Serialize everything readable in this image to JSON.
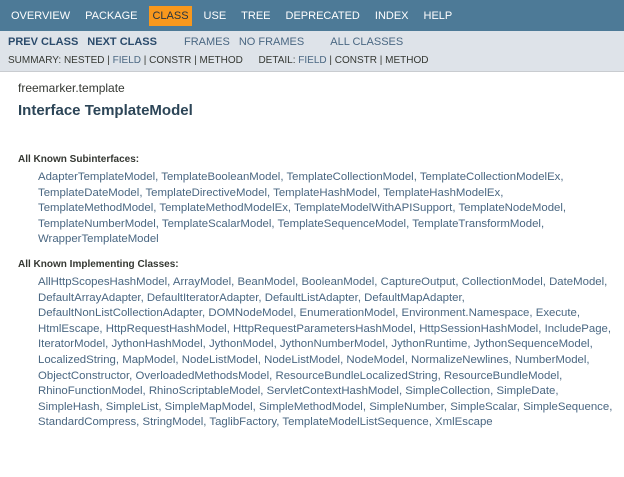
{
  "topnav": {
    "items": [
      {
        "label": "OVERVIEW",
        "active": false
      },
      {
        "label": "PACKAGE",
        "active": false
      },
      {
        "label": "CLASS",
        "active": true
      },
      {
        "label": "USE",
        "active": false
      },
      {
        "label": "TREE",
        "active": false
      },
      {
        "label": "DEPRECATED",
        "active": false
      },
      {
        "label": "INDEX",
        "active": false
      },
      {
        "label": "HELP",
        "active": false
      }
    ]
  },
  "subnav": {
    "prev_class": "PREV CLASS",
    "next_class": "NEXT CLASS",
    "frames": "FRAMES",
    "no_frames": "NO FRAMES",
    "all_classes": "ALL CLASSES",
    "summary_label": "SUMMARY: NESTED |",
    "summary_field": "FIELD",
    "summary_rest": "| CONSTR | METHOD",
    "detail_label": "DETAIL:",
    "detail_field": "FIELD",
    "detail_rest": "| CONSTR | METHOD"
  },
  "header": {
    "package": "freemarker.template",
    "title": "Interface TemplateModel"
  },
  "subinterfaces": {
    "label": "All Known Subinterfaces:",
    "items": [
      "AdapterTemplateModel",
      "TemplateBooleanModel",
      "TemplateCollectionModel",
      "TemplateCollectionModelEx",
      "TemplateDateModel",
      "TemplateDirectiveModel",
      "TemplateHashModel",
      "TemplateHashModelEx",
      "TemplateMethodModel",
      "TemplateMethodModelEx",
      "TemplateModelWithAPISupport",
      "TemplateNodeModel",
      "TemplateNumberModel",
      "TemplateScalarModel",
      "TemplateSequenceModel",
      "TemplateTransformModel",
      "WrapperTemplateModel"
    ]
  },
  "implementing": {
    "label": "All Known Implementing Classes:",
    "items": [
      "AllHttpScopesHashModel",
      "ArrayModel",
      "BeanModel",
      "BooleanModel",
      "CaptureOutput",
      "CollectionModel",
      "DateModel",
      "DefaultArrayAdapter",
      "DefaultIteratorAdapter",
      "DefaultListAdapter",
      "DefaultMapAdapter",
      "DefaultNonListCollectionAdapter",
      "DOMNodeModel",
      "EnumerationModel",
      "Environment.Namespace",
      "Execute",
      "HtmlEscape",
      "HttpRequestHashModel",
      "HttpRequestParametersHashModel",
      "HttpSessionHashModel",
      "IncludePage",
      "IteratorModel",
      "JythonHashModel",
      "JythonModel",
      "JythonNumberModel",
      "JythonRuntime",
      "JythonSequenceModel",
      "LocalizedString",
      "MapModel",
      "NodeListModel",
      "NodeListModel",
      "NodeModel",
      "NormalizeNewlines",
      "NumberModel",
      "ObjectConstructor",
      "OverloadedMethodsModel",
      "ResourceBundleLocalizedString",
      "ResourceBundleModel",
      "RhinoFunctionModel",
      "RhinoScriptableModel",
      "ServletContextHashModel",
      "SimpleCollection",
      "SimpleDate",
      "SimpleHash",
      "SimpleList",
      "SimpleMapModel",
      "SimpleMethodModel",
      "SimpleNumber",
      "SimpleScalar",
      "SimpleSequence",
      "StandardCompress",
      "StringModel",
      "TaglibFactory",
      "TemplateModelListSequence",
      "XmlEscape"
    ]
  }
}
